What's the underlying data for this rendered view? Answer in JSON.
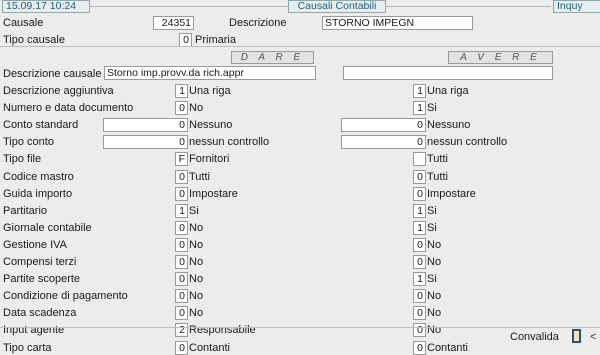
{
  "header": {
    "datetime": "15.09.17 10:24",
    "title": "Causali Contabili",
    "mode": "Inquy"
  },
  "top": {
    "causale_label": "Causale",
    "causale_value": "24351",
    "descrizione_label": "Descrizione",
    "descrizione_value": "STORNO IMPEGN PROV.APPR.",
    "tipo_label": "Tipo causale",
    "tipo_value": "0",
    "tipo_text": "Primaria"
  },
  "sections": {
    "dare": "D A R E",
    "avere": "A V E R E"
  },
  "desc_causale": {
    "label": "Descrizione causale",
    "dare": "Storno imp.provv.da rich.appr",
    "avere": ""
  },
  "rows": [
    {
      "label": "Descrizione aggiuntiva",
      "dare_val": "1",
      "dare_text": "Una riga",
      "avere_val": "1",
      "avere_text": "Una riga"
    },
    {
      "label": "Numero e data documento",
      "dare_val": "0",
      "dare_text": "No",
      "avere_val": "1",
      "avere_text": "Si"
    },
    {
      "label": "Conto standard",
      "dare_val": "0",
      "dare_text": "Nessuno",
      "avere_val": "0",
      "avere_text": "Nessuno"
    },
    {
      "label": "Tipo conto",
      "dare_val": "0",
      "dare_text": "nessun controllo",
      "avere_val": "0",
      "avere_text": "nessun controllo"
    },
    {
      "label": "Tipo file",
      "dare_val": "F",
      "dare_text": "Fornitori",
      "avere_val": "",
      "avere_text": "Tutti"
    },
    {
      "label": "Codice mastro",
      "dare_val": "0",
      "dare_text": "Tutti",
      "avere_val": "0",
      "avere_text": "Tutti"
    },
    {
      "label": "Guida importo",
      "dare_val": "0",
      "dare_text": "Impostare",
      "avere_val": "0",
      "avere_text": "Impostare"
    },
    {
      "label": "Partitario",
      "dare_val": "1",
      "dare_text": "Si",
      "avere_val": "1",
      "avere_text": "Si"
    },
    {
      "label": "Giornale contabile",
      "dare_val": "0",
      "dare_text": "No",
      "avere_val": "1",
      "avere_text": "Si"
    },
    {
      "label": "Gestione IVA",
      "dare_val": "0",
      "dare_text": "No",
      "avere_val": "0",
      "avere_text": "No"
    },
    {
      "label": "Compensi terzi",
      "dare_val": "0",
      "dare_text": "No",
      "avere_val": "0",
      "avere_text": "No"
    },
    {
      "label": "Partite scoperte",
      "dare_val": "0",
      "dare_text": "No",
      "avere_val": "1",
      "avere_text": "Si"
    },
    {
      "label": "Condizione di pagamento",
      "dare_val": "0",
      "dare_text": "No",
      "avere_val": "0",
      "avere_text": "No"
    },
    {
      "label": "Data scadenza",
      "dare_val": "0",
      "dare_text": "No",
      "avere_val": "0",
      "avere_text": "No"
    },
    {
      "label": "Input agente",
      "dare_val": "2",
      "dare_text": "Responsabile",
      "avere_val": "0",
      "avere_text": "No"
    },
    {
      "label": "Tipo carta",
      "dare_val": "0",
      "dare_text": "Contanti",
      "avere_val": "0",
      "avere_text": "Contanti"
    }
  ],
  "footer": {
    "convalida": "Convalida",
    "arrow": "<"
  }
}
